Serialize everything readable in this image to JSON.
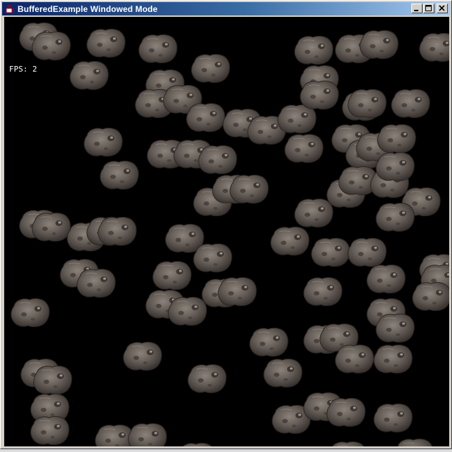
{
  "window": {
    "title": "BufferedExample Windowed Mode",
    "app_icon": "java-cup-icon",
    "controls": [
      "minimize-icon",
      "maximize-icon",
      "close-icon"
    ]
  },
  "canvas": {
    "background": "#000000",
    "fps_text": "FPS:  2",
    "sprite_name": "asteroid-sprite",
    "sprite_color": "#6b625b"
  }
}
